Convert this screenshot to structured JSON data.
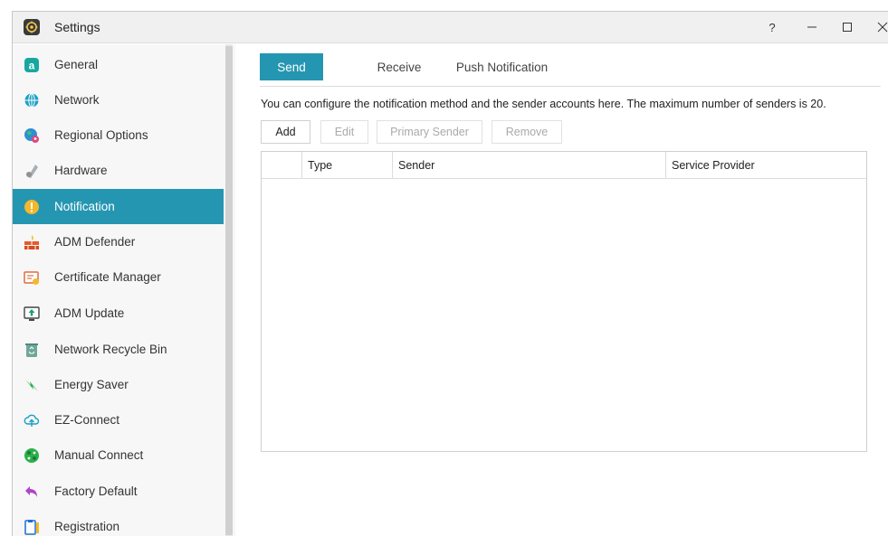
{
  "window": {
    "title": "Settings",
    "help_glyph": "?",
    "minimize_glyph": "—",
    "maximize_glyph": "☐",
    "close_glyph": "✕"
  },
  "sidebar": {
    "items": [
      {
        "label": "General",
        "icon": "general-icon",
        "color": "#16a8a0"
      },
      {
        "label": "Network",
        "icon": "globe-icon",
        "color": "#1a9fc4"
      },
      {
        "label": "Regional Options",
        "icon": "regional-globe-icon",
        "color": "#2f8fd0"
      },
      {
        "label": "Hardware",
        "icon": "hardware-icon",
        "color": "#9aa0a6"
      },
      {
        "label": "Notification",
        "icon": "exclamation-icon",
        "color": "#f4b82c",
        "active": true
      },
      {
        "label": "ADM Defender",
        "icon": "firewall-icon",
        "color": "#e85a2a"
      },
      {
        "label": "Certificate Manager",
        "icon": "certificate-icon",
        "color": "#e06c3c"
      },
      {
        "label": "ADM Update",
        "icon": "update-icon",
        "color": "#1b9c7a"
      },
      {
        "label": "Network Recycle Bin",
        "icon": "recycle-bin-icon",
        "color": "#5a9a8a"
      },
      {
        "label": "Energy Saver",
        "icon": "energy-icon",
        "color": "#2bb04a"
      },
      {
        "label": "EZ-Connect",
        "icon": "cloud-upload-icon",
        "color": "#1a9fc4"
      },
      {
        "label": "Manual Connect",
        "icon": "manual-connect-icon",
        "color": "#2bb04a"
      },
      {
        "label": "Factory Default",
        "icon": "undo-icon",
        "color": "#b043c8"
      },
      {
        "label": "Registration",
        "icon": "registration-icon",
        "color": "#1d6fd0"
      }
    ]
  },
  "tabs": [
    {
      "label": "Send",
      "active": true
    },
    {
      "label": "Receive",
      "active": false
    },
    {
      "label": "Push Notification",
      "active": false
    }
  ],
  "description": "You can configure the notification method and the sender accounts here. The maximum number of senders is 20.",
  "toolbar": {
    "add": "Add",
    "edit": "Edit",
    "primary_sender": "Primary Sender",
    "remove": "Remove"
  },
  "grid": {
    "columns": [
      "",
      "Type",
      "Sender",
      "Service Provider"
    ],
    "rows": []
  },
  "colors": {
    "accent": "#2596b1"
  }
}
